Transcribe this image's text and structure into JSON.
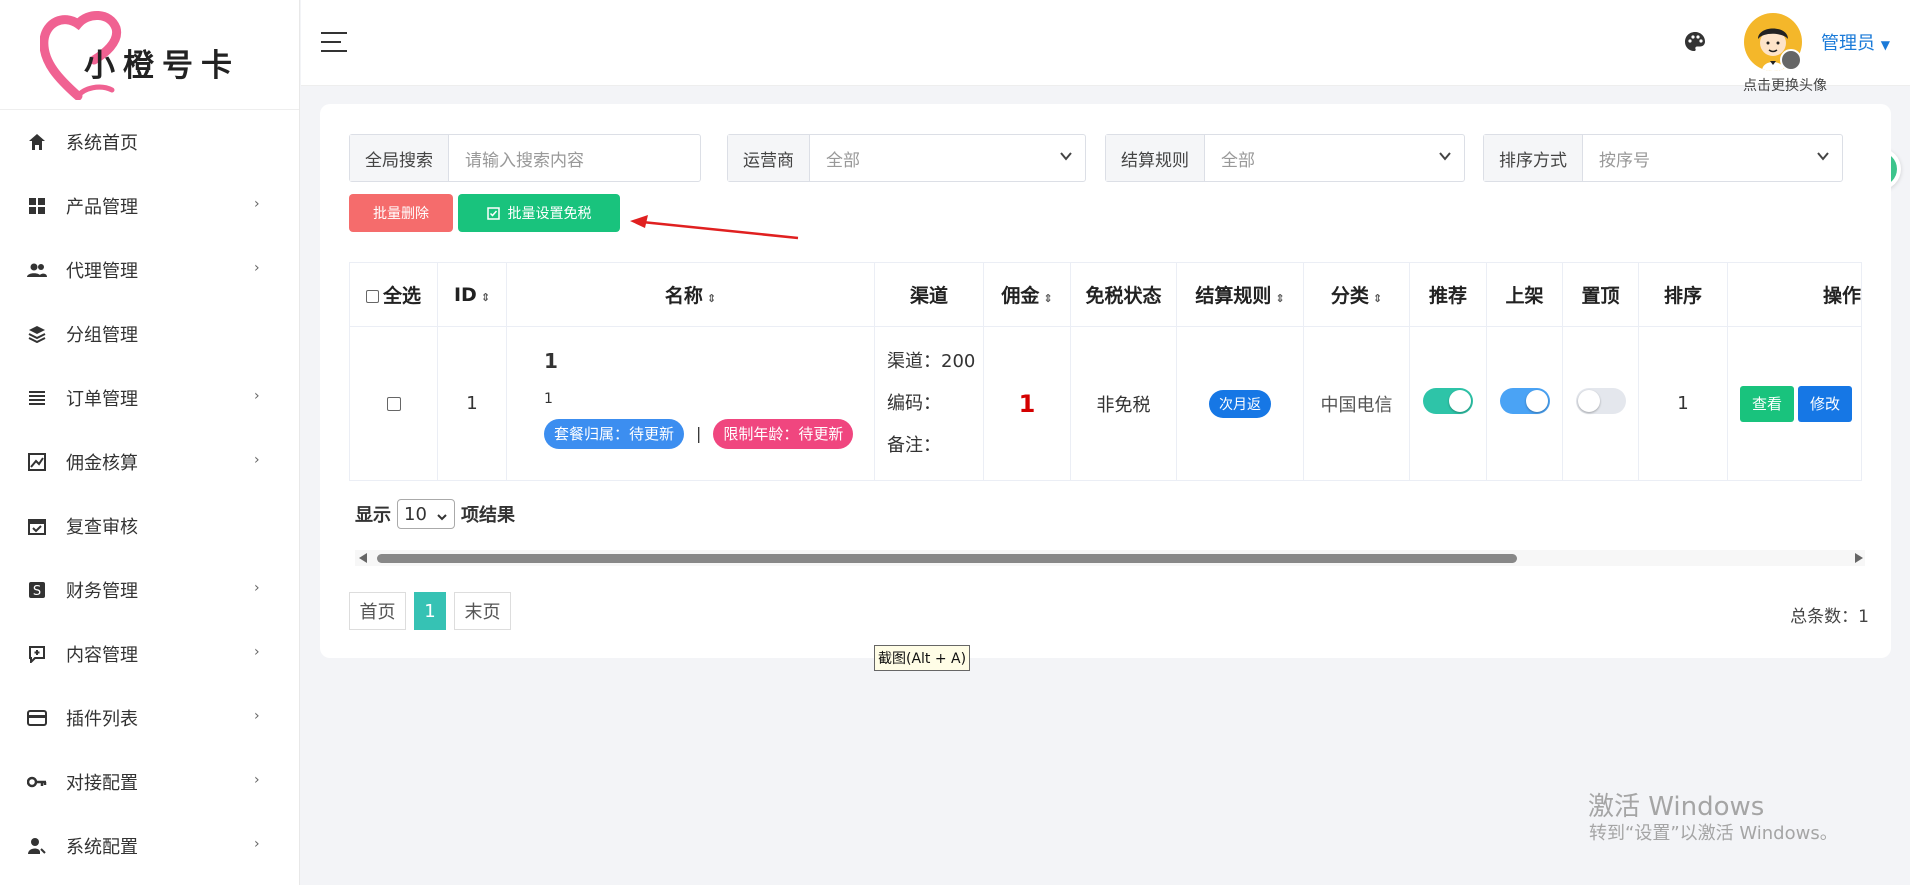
{
  "brand": {
    "logo_text": "小橙号卡"
  },
  "sidebar": {
    "items": [
      {
        "label": "系统首页",
        "icon": "home-icon",
        "has_children": false
      },
      {
        "label": "产品管理",
        "icon": "grid-icon",
        "has_children": true
      },
      {
        "label": "代理管理",
        "icon": "users-icon",
        "has_children": true
      },
      {
        "label": "分组管理",
        "icon": "layers-icon",
        "has_children": false
      },
      {
        "label": "订单管理",
        "icon": "list-icon",
        "has_children": true
      },
      {
        "label": "佣金核算",
        "icon": "chart-icon",
        "has_children": true
      },
      {
        "label": "复查审核",
        "icon": "calendar-check-icon",
        "has_children": false
      },
      {
        "label": "财务管理",
        "icon": "dollar-icon",
        "has_children": true
      },
      {
        "label": "内容管理",
        "icon": "content-icon",
        "has_children": true
      },
      {
        "label": "插件列表",
        "icon": "card-icon",
        "has_children": true
      },
      {
        "label": "对接配置",
        "icon": "key-icon",
        "has_children": true
      },
      {
        "label": "系统配置",
        "icon": "user-gear-icon",
        "has_children": true
      }
    ]
  },
  "header": {
    "admin_name": "管理员",
    "avatar_hint": "点击更换头像"
  },
  "filters": {
    "search_label": "全局搜索",
    "search_placeholder": "请输入搜索内容",
    "carrier_label": "运营商",
    "carrier_value": "全部",
    "settlement_label": "结算规则",
    "settlement_value": "全部",
    "sort_label": "排序方式",
    "sort_value": "按序号"
  },
  "actions": {
    "batch_delete": "批量删除",
    "batch_tax_free": "批量设置免税"
  },
  "table": {
    "headers": {
      "select_all": "全选",
      "id": "ID",
      "name": "名称",
      "channel": "渠道",
      "commission": "佣金",
      "tax_status": "免税状态",
      "settlement": "结算规则",
      "category": "分类",
      "recommend": "推荐",
      "listed": "上架",
      "pinned": "置顶",
      "order": "排序",
      "operations": "操作"
    },
    "rows": [
      {
        "id": "1",
        "name_title": "1",
        "name_sub": "1",
        "tag_attribution": "套餐归属：待更新",
        "tag_sep": "|",
        "tag_age": "限制年龄：待更新",
        "channel_line": "渠道：200",
        "code_line": "编码：",
        "note_line": "备注：",
        "commission": "1",
        "tax_status": "非免税",
        "settlement": "次月返",
        "category": "中国电信",
        "recommend": true,
        "listed": true,
        "pinned": false,
        "order": "1",
        "op_view": "查看",
        "op_edit": "修改"
      }
    ]
  },
  "pagination": {
    "show_label": "显示",
    "page_size": "10",
    "result_label": "项结果",
    "first": "首页",
    "current": "1",
    "last": "末页",
    "total_text": "总条数：1"
  },
  "tooltip": "截图(Alt + A)",
  "watermark": {
    "line1": "激活 Windows",
    "line2": "转到“设置”以激活 Windows。"
  },
  "colors": {
    "danger": "#f56c6c",
    "success": "#19c37d",
    "primary": "#1677e5",
    "commission": "#d40000",
    "pager_active": "#36c2b4"
  }
}
